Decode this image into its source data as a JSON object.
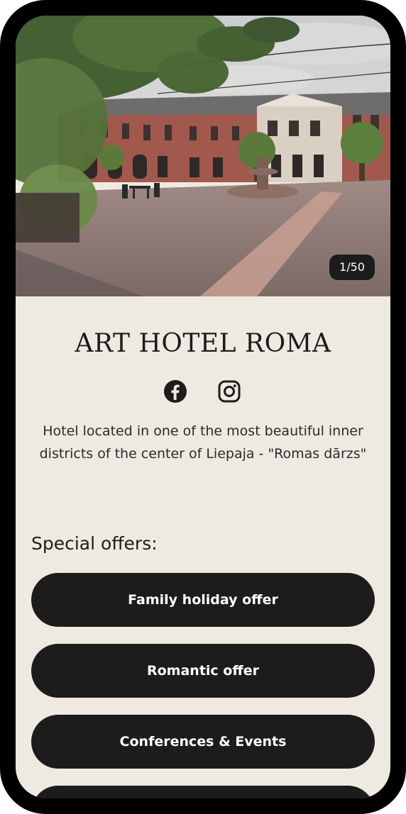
{
  "hotel": {
    "name": "ART HOTEL ROMA",
    "description": "Hotel located in one of the most beautiful inner districts of the center of Liepaja - \"Romas dārzs\""
  },
  "gallery": {
    "counter": "1/50"
  },
  "social": [
    {
      "icon": "facebook-icon"
    },
    {
      "icon": "instagram-icon"
    }
  ],
  "offers": {
    "heading": "Special offers:",
    "items": [
      {
        "label": "Family holiday offer"
      },
      {
        "label": "Romantic offer"
      },
      {
        "label": "Conferences & Events"
      },
      {
        "label": ""
      }
    ]
  },
  "colors": {
    "background": "#efeae1",
    "button": "#1c1c1c",
    "text": "#1c1c1c"
  }
}
